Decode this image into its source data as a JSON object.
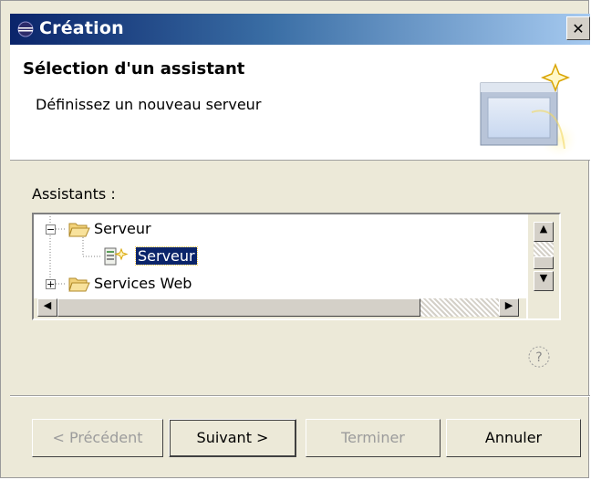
{
  "window": {
    "title": "Création",
    "close_glyph": "✕"
  },
  "banner": {
    "title": "Sélection d'un assistant",
    "description": "Définissez un nouveau serveur",
    "graphic_icon": "new-wizard-icon"
  },
  "assistants": {
    "label": "Assistants :",
    "tree": [
      {
        "label": "Serveur",
        "icon": "folder-open-icon",
        "expanded": true,
        "level": 0
      },
      {
        "label": "Serveur",
        "icon": "server-wizard-icon",
        "selected": true,
        "level": 1
      },
      {
        "label": "Services Web",
        "icon": "folder-icon",
        "expanded": false,
        "level": 0
      }
    ]
  },
  "buttons": {
    "back": "< Précédent",
    "next": "Suivant >",
    "finish": "Terminer",
    "cancel": "Annuler"
  },
  "colors": {
    "title_bar_start": "#0a246a",
    "title_bar_end": "#a6caf0",
    "selection": "#0a246a",
    "dialog_bg": "#ece9d8"
  }
}
